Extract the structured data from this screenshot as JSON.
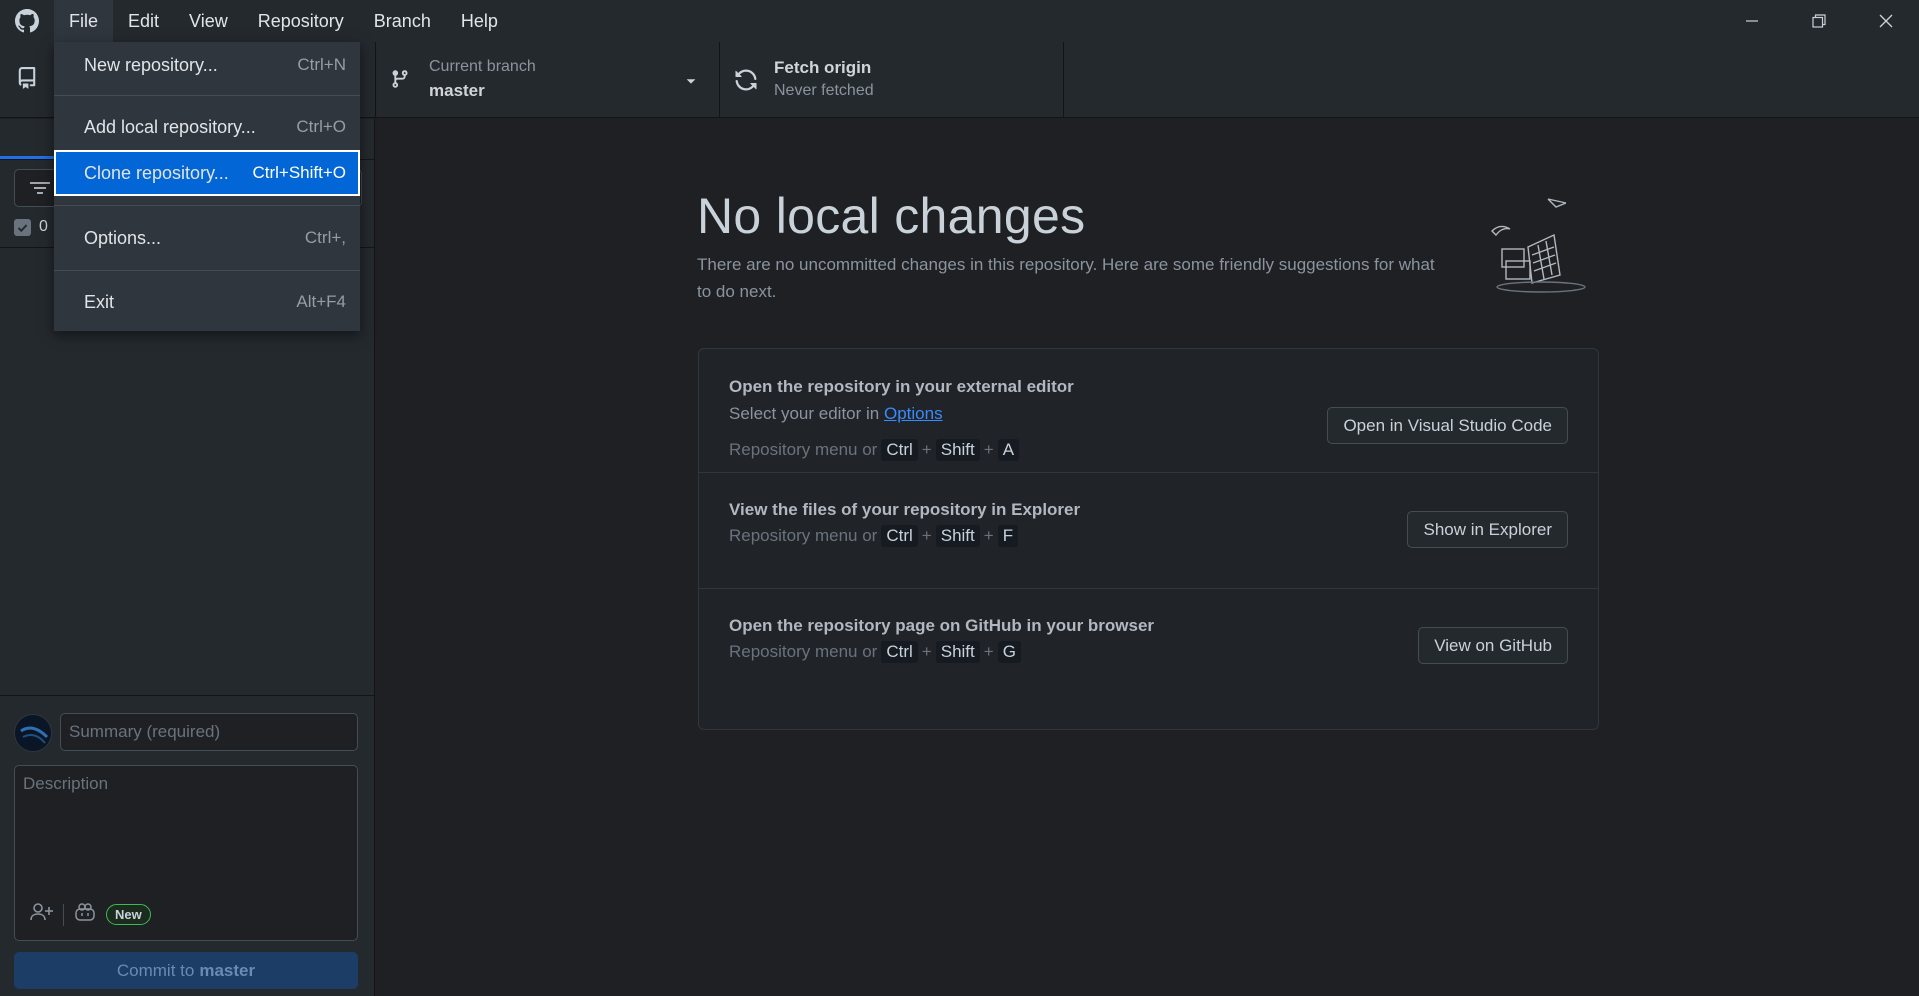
{
  "menubar": {
    "items": [
      "File",
      "Edit",
      "View",
      "Repository",
      "Branch",
      "Help"
    ]
  },
  "toolbar": {
    "branch_label": "Current branch",
    "branch_value": "master",
    "fetch_label": "Fetch origin",
    "fetch_status": "Never fetched"
  },
  "sidebar": {
    "changes_count": "0"
  },
  "file_menu": {
    "items": [
      {
        "label": "New repository...",
        "accel": "Ctrl+N"
      },
      {
        "label": "Add local repository...",
        "accel": "Ctrl+O"
      },
      {
        "label": "Clone repository...",
        "accel": "Ctrl+Shift+O"
      },
      {
        "label": "Options...",
        "accel": "Ctrl+,"
      },
      {
        "label": "Exit",
        "accel": "Alt+F4"
      }
    ]
  },
  "commit": {
    "summary_placeholder": "Summary (required)",
    "description_placeholder": "Description",
    "new_badge": "New",
    "button_prefix": "Commit to",
    "button_branch": "master"
  },
  "main": {
    "title": "No local changes",
    "description": "There are no uncommitted changes in this repository. Here are some friendly suggestions for what to do next.",
    "suggestions": [
      {
        "title": "Open the repository in your external editor",
        "line": "Select your editor in",
        "link": "Options",
        "shortcut_prefix": "Repository menu or",
        "keys": [
          "Ctrl",
          "Shift",
          "A"
        ],
        "button": "Open in Visual Studio Code"
      },
      {
        "title": "View the files of your repository in Explorer",
        "shortcut_prefix": "Repository menu or",
        "keys": [
          "Ctrl",
          "Shift",
          "F"
        ],
        "button": "Show in Explorer"
      },
      {
        "title": "Open the repository page on GitHub in your browser",
        "shortcut_prefix": "Repository menu or",
        "keys": [
          "Ctrl",
          "Shift",
          "G"
        ],
        "button": "View on GitHub"
      }
    ]
  },
  "icons": {
    "app_logo": "github-icon",
    "repo": "repo-icon",
    "branch": "git-branch-icon",
    "fetch": "sync-icon",
    "filter": "filter-icon",
    "coauthor": "person-add-icon",
    "copilot": "copilot-icon"
  },
  "colors": {
    "accent": "#0366d6",
    "background": "#1e2024",
    "toolbar": "#24292e"
  }
}
